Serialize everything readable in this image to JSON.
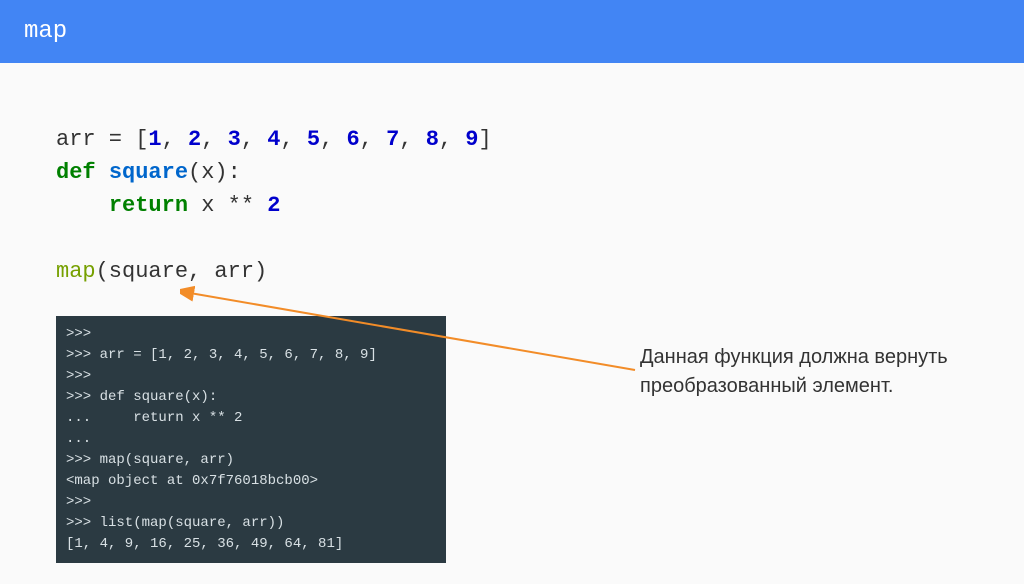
{
  "header": {
    "title": "map"
  },
  "code": {
    "line1_pre": "arr = [",
    "line1_nums": [
      "1",
      "2",
      "3",
      "4",
      "5",
      "6",
      "7",
      "8",
      "9"
    ],
    "line1_post": "]",
    "line2_def": "def",
    "line2_fn": "square",
    "line2_rest": "(x):",
    "line3_return": "return",
    "line3_expr": " x ** ",
    "line3_num": "2",
    "line4_call": "map",
    "line4_args": "(square, arr)"
  },
  "terminal": {
    "lines": [
      ">>>",
      ">>> arr = [1, 2, 3, 4, 5, 6, 7, 8, 9]",
      ">>>",
      ">>> def square(x):",
      "...     return x ** 2",
      "...",
      ">>> map(square, arr)",
      "<map object at 0x7f76018bcb00>",
      ">>>",
      ">>> list(map(square, arr))",
      "[1, 4, 9, 16, 25, 36, 49, 64, 81]"
    ]
  },
  "annotation": {
    "text": "Данная функция должна вернуть преобразованный элемент."
  },
  "colors": {
    "header_bg": "#4285f4",
    "arrow": "#f28c28"
  }
}
